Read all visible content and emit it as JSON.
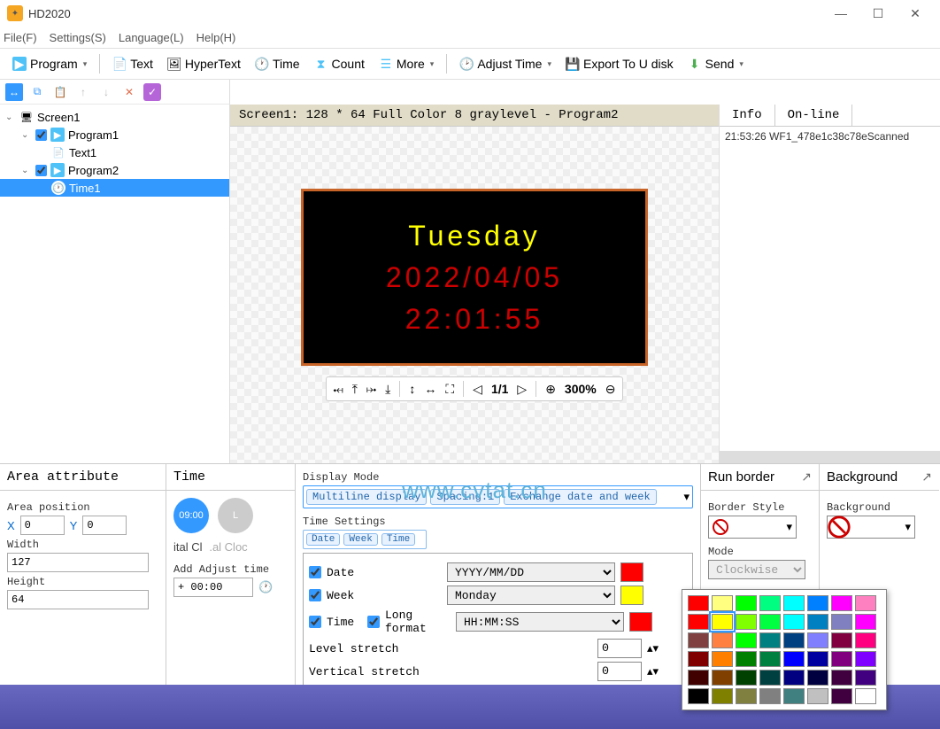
{
  "app": {
    "title": "HD2020"
  },
  "menu": {
    "file": "File(F)",
    "settings": "Settings(S)",
    "language": "Language(L)",
    "help": "Help(H)"
  },
  "toolbar": {
    "program": "Program",
    "text": "Text",
    "hypertext": "HyperText",
    "time": "Time",
    "count": "Count",
    "more": "More",
    "adjust": "Adjust Time",
    "export": "Export To U disk",
    "send": "Send"
  },
  "tree": {
    "root": "Screen1",
    "p1": "Program1",
    "p1_t1": "Text1",
    "p2": "Program2",
    "p2_t1": "Time1"
  },
  "breadcrumb": "Screen1: 128 * 64 Full Color 8 graylevel - Program2",
  "preview": {
    "week": "Tuesday",
    "date": "2022/04/05",
    "time": "22:01:55",
    "watermark": "www.cvtat.cn"
  },
  "previewctrl": {
    "page": "1/1",
    "zoom": "300%"
  },
  "info": {
    "tab1": "Info",
    "tab2": "On-line",
    "log": "21:53:26 WF1_478e1c38c78eScanned"
  },
  "area": {
    "header": "Area attribute",
    "pos": "Area position",
    "x": "X",
    "xv": "0",
    "y": "Y",
    "yv": "0",
    "width": "Width",
    "wv": "127",
    "height": "Height",
    "hv": "64"
  },
  "timecol": {
    "header": "Time",
    "digital": "ital Cl",
    "analog": ".al Cloc",
    "adjust": "Add Adjust time",
    "adjustv": "+ 00:00",
    "clock_time": "09:00",
    "clock_letter": "L"
  },
  "display": {
    "mode_lbl": "Display Mode",
    "tag1": "Multiline display",
    "tag2": "Spacing:1",
    "tag3": "Exchange date and week",
    "ts_lbl": "Time Settings",
    "tdate": "Date",
    "tweek": "Week",
    "ttime": "Time",
    "cb_date": "Date",
    "cb_week": "Week",
    "cb_time": "Time",
    "cb_long": "Long format",
    "sel_date": "YYYY/MM/DD",
    "sel_week": "Monday",
    "sel_time": "HH:MM:SS",
    "level": "Level stretch",
    "levelv": "0",
    "vert": "Vertical stretch",
    "vertv": "0"
  },
  "border": {
    "header": "Run border",
    "style": "Border Style",
    "mode": "Mode",
    "modev": "Clockwise"
  },
  "bg": {
    "header": "Background",
    "label": "Background"
  },
  "colors": {
    "row1": [
      "#ff0000",
      "#ffff80",
      "#00ff00",
      "#00ff80",
      "#00ffff",
      "#0080ff",
      "#ff00ff",
      "#ff80c0"
    ],
    "row2": [
      "#ff0000",
      "#ffff00",
      "#80ff00",
      "#00ff40",
      "#00ffff",
      "#0080c0",
      "#8080c0",
      "#ff00ff"
    ],
    "row3": [
      "#804040",
      "#ff8040",
      "#00ff00",
      "#008080",
      "#004080",
      "#8080ff",
      "#800040",
      "#ff0080"
    ],
    "row4": [
      "#800000",
      "#ff8000",
      "#008000",
      "#008040",
      "#0000ff",
      "#0000a0",
      "#800080",
      "#8000ff"
    ],
    "row5": [
      "#400000",
      "#804000",
      "#004000",
      "#004040",
      "#000080",
      "#000040",
      "#400040",
      "#400080"
    ],
    "row6": [
      "#000000",
      "#808000",
      "#808040",
      "#808080",
      "#408080",
      "#c0c0c0",
      "#400040",
      "#ffffff"
    ]
  }
}
